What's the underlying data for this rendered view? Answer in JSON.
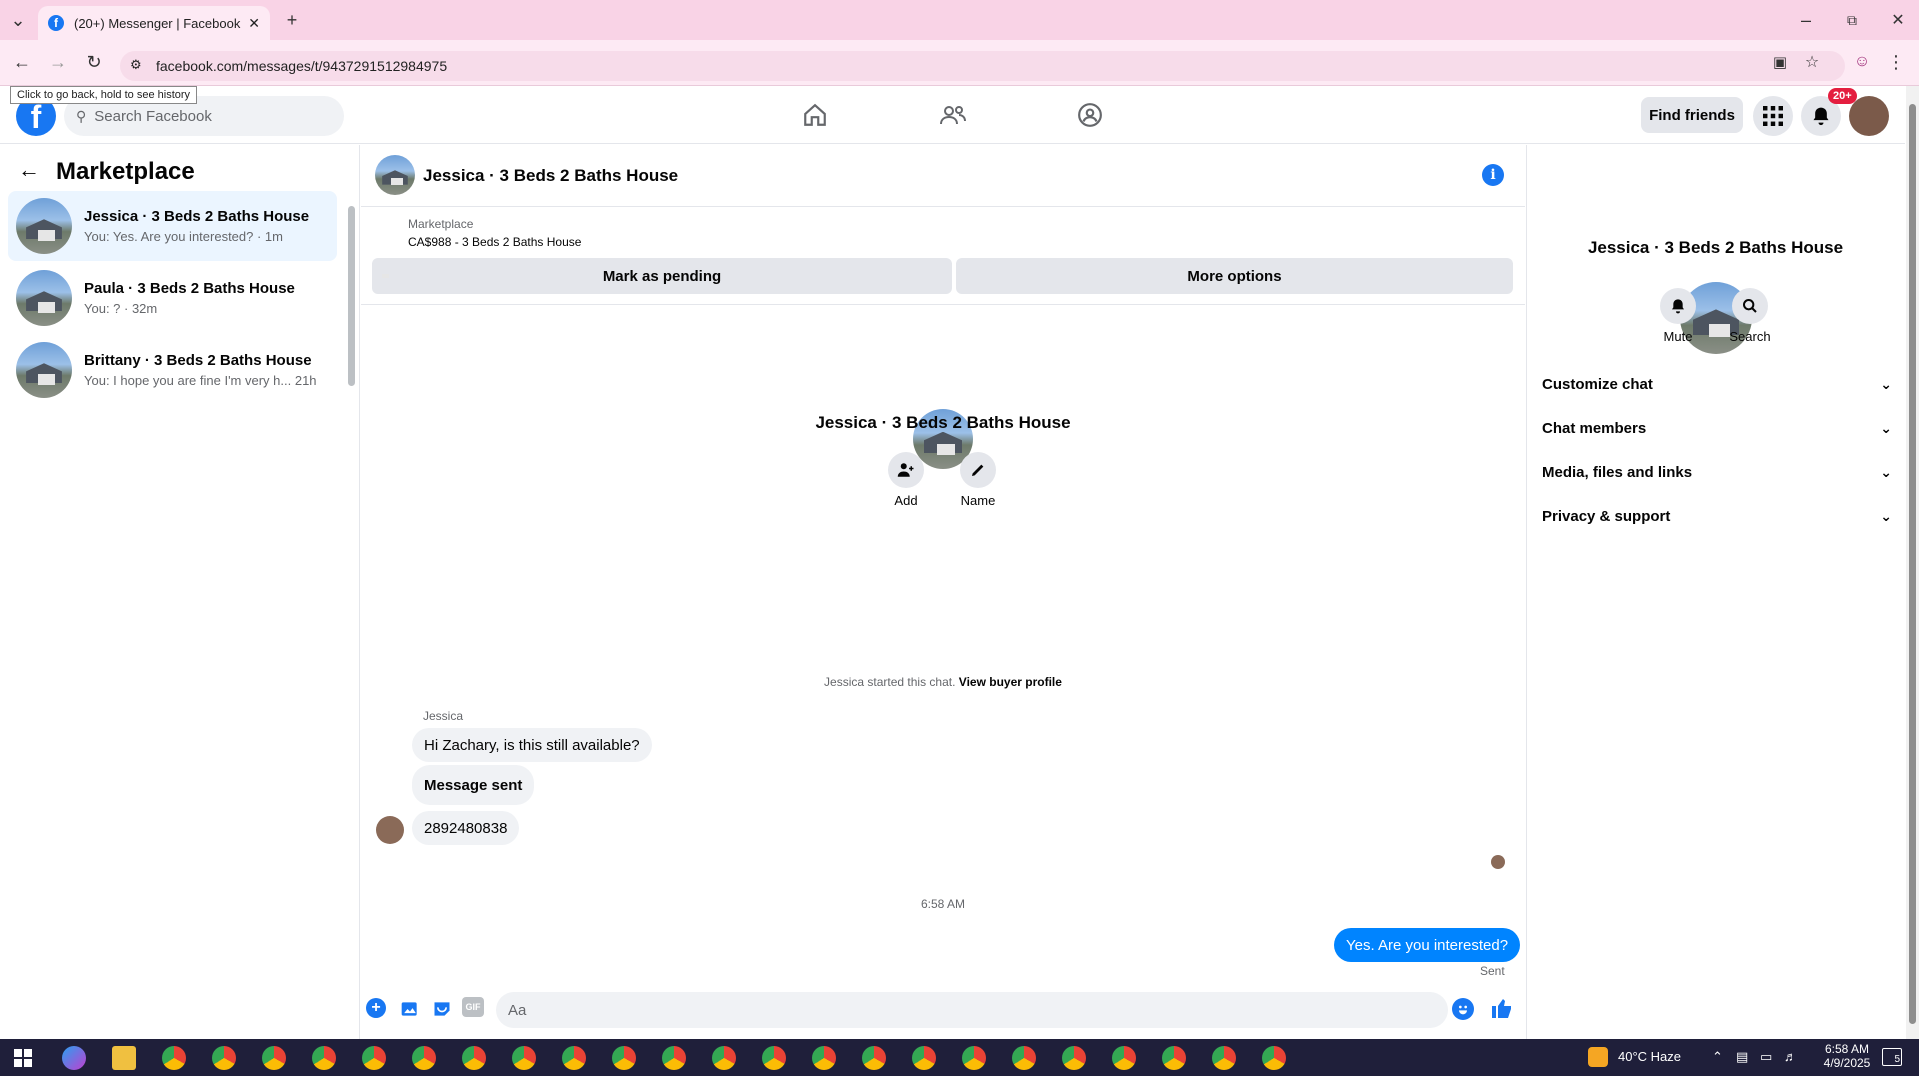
{
  "browser": {
    "tab_title": "(20+) Messenger | Facebook",
    "url": "facebook.com/messages/t/9437291512984975",
    "tooltip": "Click to go back, hold to see history"
  },
  "header": {
    "search_placeholder": "Search Facebook",
    "find_friends": "Find friends",
    "notif_badge": "20+"
  },
  "left": {
    "title": "Marketplace",
    "conversations": [
      {
        "name": "Jessica · 3 Beds 2 Baths House",
        "sub": "You: Yes. Are you interested? · 1m"
      },
      {
        "name": "Paula · 3 Beds 2 Baths House",
        "sub": "You: ? · 32m"
      },
      {
        "name": "Brittany · 3 Beds 2 Baths House",
        "sub": "You: I hope you are fine I'm very h...  21h"
      }
    ]
  },
  "chat": {
    "title": "Jessica · 3 Beds 2 Baths House",
    "marketplace_label": "Marketplace",
    "listing": "CA$988 - 3 Beds 2 Baths House",
    "mark_pending": "Mark as pending",
    "more_options": "More options",
    "center_name": "Jessica · 3 Beds 2 Baths House",
    "add_label": "Add",
    "name_label": "Name",
    "started": "Jessica started this chat.",
    "view_profile": "View buyer profile",
    "sender": "Jessica",
    "messages": [
      "Hi Zachary, is this still available?",
      "Message sent",
      "2892480838"
    ],
    "time": "6:58 AM",
    "my_message": "Yes. Are you interested?",
    "sent": "Sent",
    "composer_placeholder": "Aa",
    "gif": "GIF"
  },
  "right": {
    "name": "Jessica · 3 Beds 2 Baths House",
    "mute": "Mute",
    "search": "Search",
    "items": [
      "Customize chat",
      "Chat members",
      "Media, files and links",
      "Privacy & support"
    ]
  },
  "taskbar": {
    "weather": "40°C  Haze",
    "clock_time": "6:58 AM",
    "clock_date": "4/9/2025",
    "notif_count": "5"
  },
  "colors": {
    "accent": "#1877f2",
    "bubble_mine": "#0084ff",
    "chrome_tab": "#f9d3e6"
  }
}
